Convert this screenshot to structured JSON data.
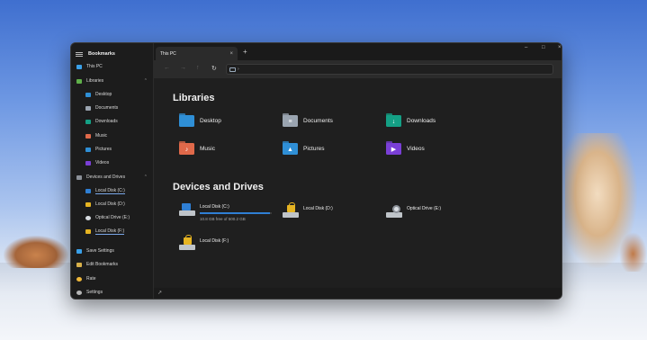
{
  "sidebar": {
    "header": "Bookmarks",
    "this_pc": "This PC",
    "libraries": {
      "label": "Libraries",
      "items": [
        "Desktop",
        "Documents",
        "Downloads",
        "Music",
        "Pictures",
        "Videos"
      ]
    },
    "devices": {
      "label": "Devices and Drives",
      "items": [
        "Local Disk (C:)",
        "Local Disk (D:)",
        "Optical Drive (E:)",
        "Local Disk (F:)"
      ]
    },
    "footer": [
      "Save Settings",
      "Edit Bookmarks",
      "Rate",
      "Settings"
    ]
  },
  "tabs": {
    "active": "This PC",
    "close": "×",
    "new": "+"
  },
  "window_controls": {
    "minimize": "–",
    "maximize": "□",
    "close": "×"
  },
  "toolbar": {
    "back": "←",
    "forward": "→",
    "up": "↑",
    "refresh": "↻",
    "separator": "›"
  },
  "main": {
    "libraries_title": "Libraries",
    "libraries": [
      {
        "label": "Desktop",
        "color": "#2f8fd6",
        "glyph": ""
      },
      {
        "label": "Documents",
        "color": "#9aa4b0",
        "glyph": "≡"
      },
      {
        "label": "Downloads",
        "color": "#14a085",
        "glyph": "↓"
      },
      {
        "label": "Music",
        "color": "#e0694a",
        "glyph": "♪"
      },
      {
        "label": "Pictures",
        "color": "#2f8fd6",
        "glyph": "▲"
      },
      {
        "label": "Videos",
        "color": "#7a3fd6",
        "glyph": "▶"
      }
    ],
    "devices_title": "Devices and Drives",
    "drives": [
      {
        "label": "Local Disk (C:)",
        "free_text": "10.8 GB free of 500.2 GB",
        "used_fraction": 0.98,
        "icon": "windows-drive-icon"
      },
      {
        "label": "Local Disk (D:)",
        "icon": "locked-drive-icon"
      },
      {
        "label": "Optical Drive (E:)",
        "icon": "optical-drive-icon"
      },
      {
        "label": "Local Disk (F:)",
        "icon": "locked-drive-icon"
      }
    ]
  },
  "statusbar": {
    "grip": "↗"
  }
}
